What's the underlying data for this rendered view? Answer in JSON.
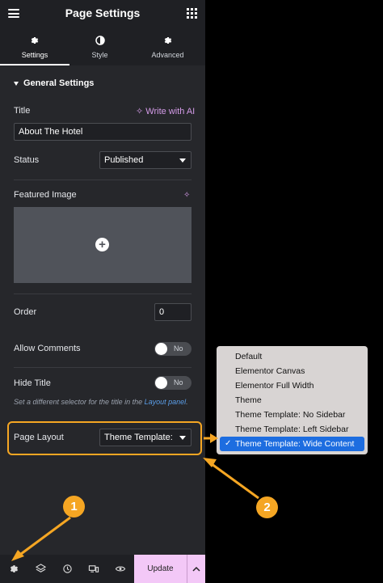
{
  "header": {
    "title": "Page Settings"
  },
  "tabs": [
    {
      "label": "Settings",
      "icon": "gear-icon"
    },
    {
      "label": "Style",
      "icon": "half-circle-icon"
    },
    {
      "label": "Advanced",
      "icon": "gear-icon"
    }
  ],
  "section": {
    "title": "General Settings"
  },
  "fields": {
    "title": {
      "label": "Title",
      "value": "About The Hotel",
      "ai_link": "Write with AI"
    },
    "status": {
      "label": "Status",
      "value": "Published"
    },
    "featured_image": {
      "label": "Featured Image"
    },
    "order": {
      "label": "Order",
      "value": "0"
    },
    "allow_comments": {
      "label": "Allow Comments",
      "state": "No"
    },
    "hide_title": {
      "label": "Hide Title",
      "state": "No"
    },
    "hint": {
      "text": "Set a different selector for the title in the ",
      "link": "Layout panel",
      "end": "."
    },
    "page_layout": {
      "label": "Page Layout",
      "value": "Theme Template: Wide Content"
    }
  },
  "dropdown": {
    "options": [
      "Default",
      "Elementor Canvas",
      "Elementor Full Width",
      "Theme",
      "Theme Template: No Sidebar",
      "Theme Template: Left Sidebar",
      "Theme Template: Wide Content"
    ],
    "selected_index": 6
  },
  "footer": {
    "update_label": "Update"
  },
  "annotations": {
    "badge1": "1",
    "badge2": "2"
  },
  "colors": {
    "accent": "#f5a623",
    "update_bg": "#f3c8f7",
    "ai": "#d49be8",
    "selected": "#1d6de0"
  }
}
